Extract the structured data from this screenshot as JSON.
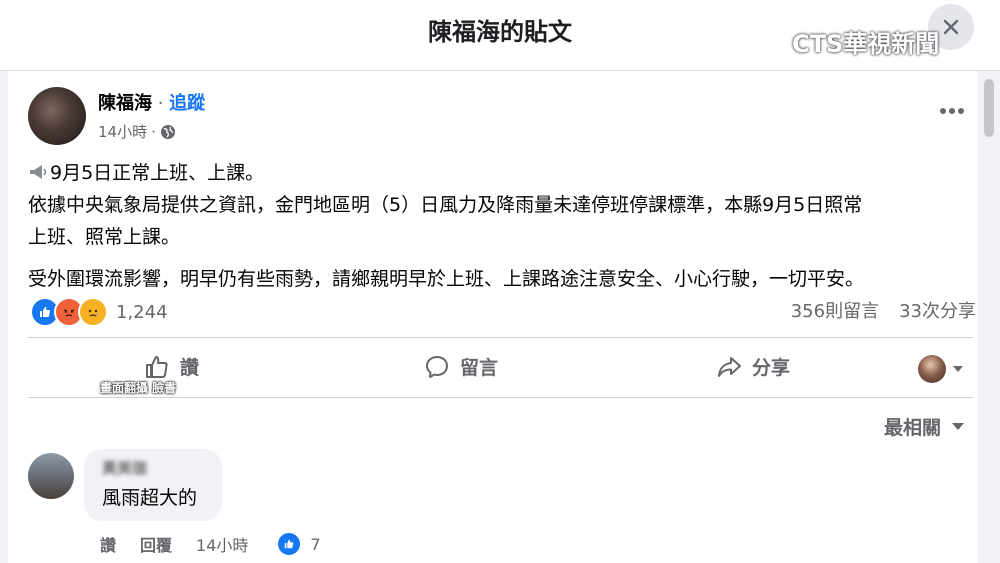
{
  "modal": {
    "title": "陳福海的貼文",
    "close_icon": "close-icon"
  },
  "watermark": "CTS華視新聞",
  "post": {
    "author": "陳福海",
    "separator": " · ",
    "follow_label": "追蹤",
    "time": "14小時",
    "privacy_icon": "globe-icon",
    "more_icon": "more-horizontal-icon",
    "lines": {
      "line1": "9月5日正常上班、上課。",
      "line2": "依據中央氣象局提供之資訊，金門地區明（5）日風力及降雨量未達停班停課標準，本縣9月5日照常",
      "line3": "上班、照常上課。",
      "line4": "受外圍環流影響，明早仍有些雨勢，請鄉親明早於上班、上課路途注意安全、小心行駛，一切平安。"
    },
    "reactions": {
      "icons": [
        "like-reaction-icon",
        "angry-reaction-icon",
        "sad-reaction-icon"
      ],
      "count": "1,244"
    },
    "stats": {
      "comments": "356則留言",
      "shares": "33次分享"
    },
    "actions": {
      "like": "讚",
      "comment": "留言",
      "share": "分享"
    },
    "caption": "畫面翻攝 臉書"
  },
  "comments_section": {
    "sort_label": "最相關",
    "comment": {
      "author": "黃美珈",
      "text": "風雨超大的",
      "like_label": "讚",
      "reply_label": "回覆",
      "time": "14小時",
      "like_count": "7"
    }
  },
  "colors": {
    "accent": "#1877f2",
    "secondary_text": "#65676b",
    "angry": "#f0613b",
    "sad": "#f7b125"
  }
}
